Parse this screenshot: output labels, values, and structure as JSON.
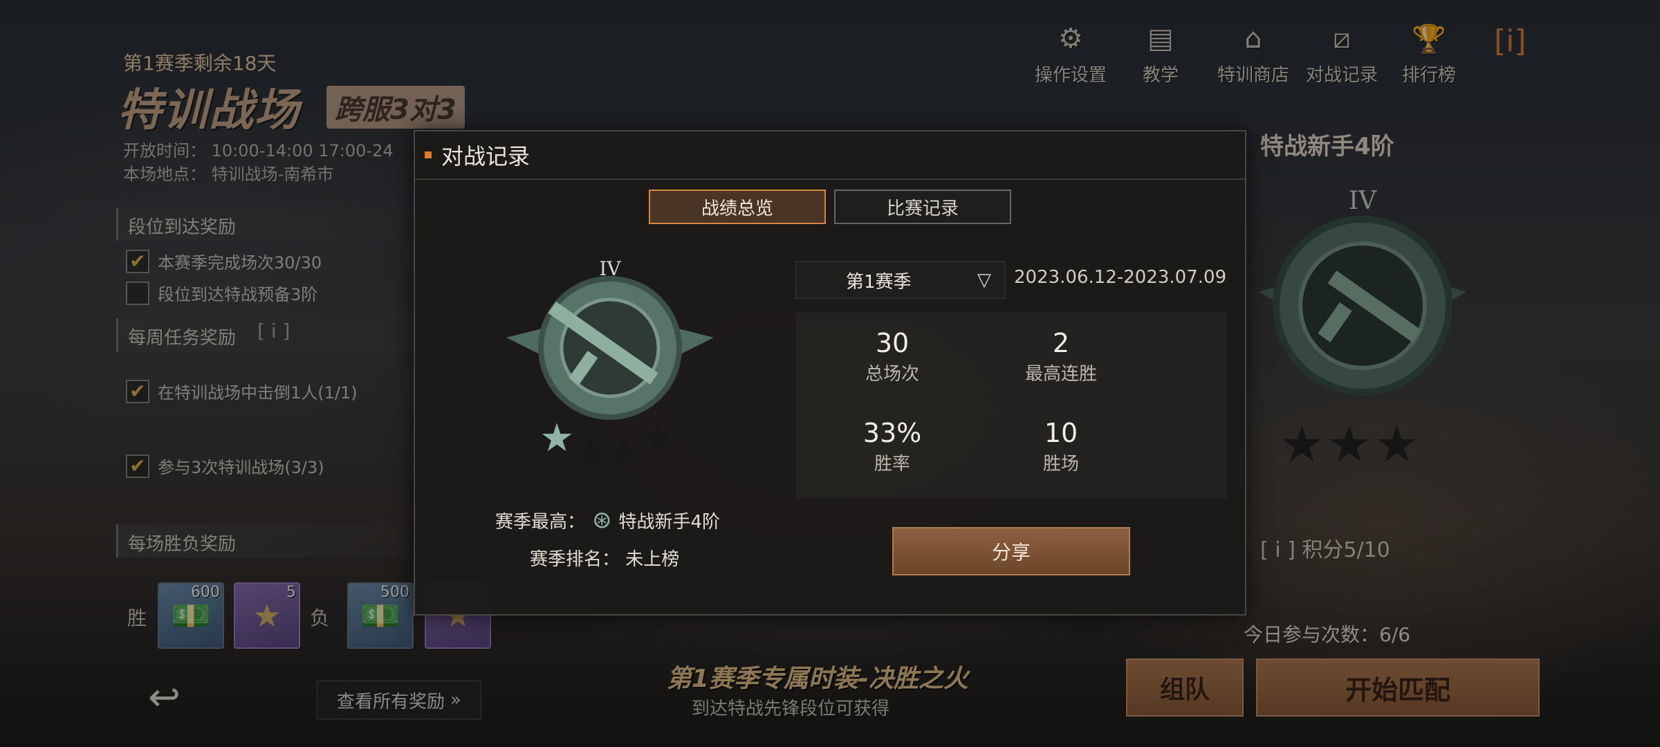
{
  "left": {
    "season_remaining": "第1赛季剩余18天",
    "mode_title": "特训战场",
    "mode_sub": "跨服3对3",
    "open_time": "开放时间： 10:00-14:00 17:00-24",
    "venue": "本场地点： 特训战场-南希市",
    "rank_section": "段位到达奖励",
    "task1": "本赛季完成场次30/30",
    "task2": "段位到达特战预备3阶",
    "weekly_section": "每周任务奖励",
    "weekly_info": "[ i ]",
    "task3": "在特训战场中击倒1人(1/1)",
    "task4": "参与3次特训战场(3/3)",
    "match_section": "每场胜负奖励",
    "win_label": "胜",
    "lose_label": "负",
    "rewards": [
      {
        "icon": "cash-icon",
        "count": "600"
      },
      {
        "icon": "star-icon",
        "count": "5"
      },
      {
        "icon": "cash-icon",
        "count": "500"
      },
      {
        "icon": "star-icon",
        "count": ""
      }
    ],
    "view_all_rewards": "查看所有奖励",
    "view_all_arrow": "»"
  },
  "toolbar": {
    "ops": "操作设置",
    "teach": "教学",
    "shop": "特训商店",
    "record": "对战记录",
    "rank": "排行榜",
    "info": "[i]"
  },
  "right": {
    "rank_title": "特战新手4阶",
    "points": "[ i ] 积分5/10",
    "today": "今日参与次数：6/6",
    "team_button": "组队",
    "match_button": "开始匹配",
    "promo_title": "第1赛季专属时装-决胜之火",
    "promo_sub": "到达特战先锋段位可获得"
  },
  "modal": {
    "title": "对战记录",
    "tabs": [
      "战绩总览",
      "比赛记录"
    ],
    "badge_tier": "IV",
    "best_label": "赛季最高：",
    "best_value": "特战新手4阶",
    "rank_label": "赛季排名：",
    "rank_value": "未上榜",
    "season_select": "第1赛季",
    "season_dates": "2023.06.12-2023.07.09",
    "stats": [
      {
        "value": "30",
        "label": "总场次"
      },
      {
        "value": "2",
        "label": "最高连胜"
      },
      {
        "value": "33%",
        "label": "胜率"
      },
      {
        "value": "10",
        "label": "胜场"
      }
    ],
    "share": "分享"
  },
  "colors": {
    "accent": "#e17a2a",
    "tab_active_border": "#d8873e",
    "button_brown": "#a06a44",
    "badge_green": "#5e7a6e"
  }
}
